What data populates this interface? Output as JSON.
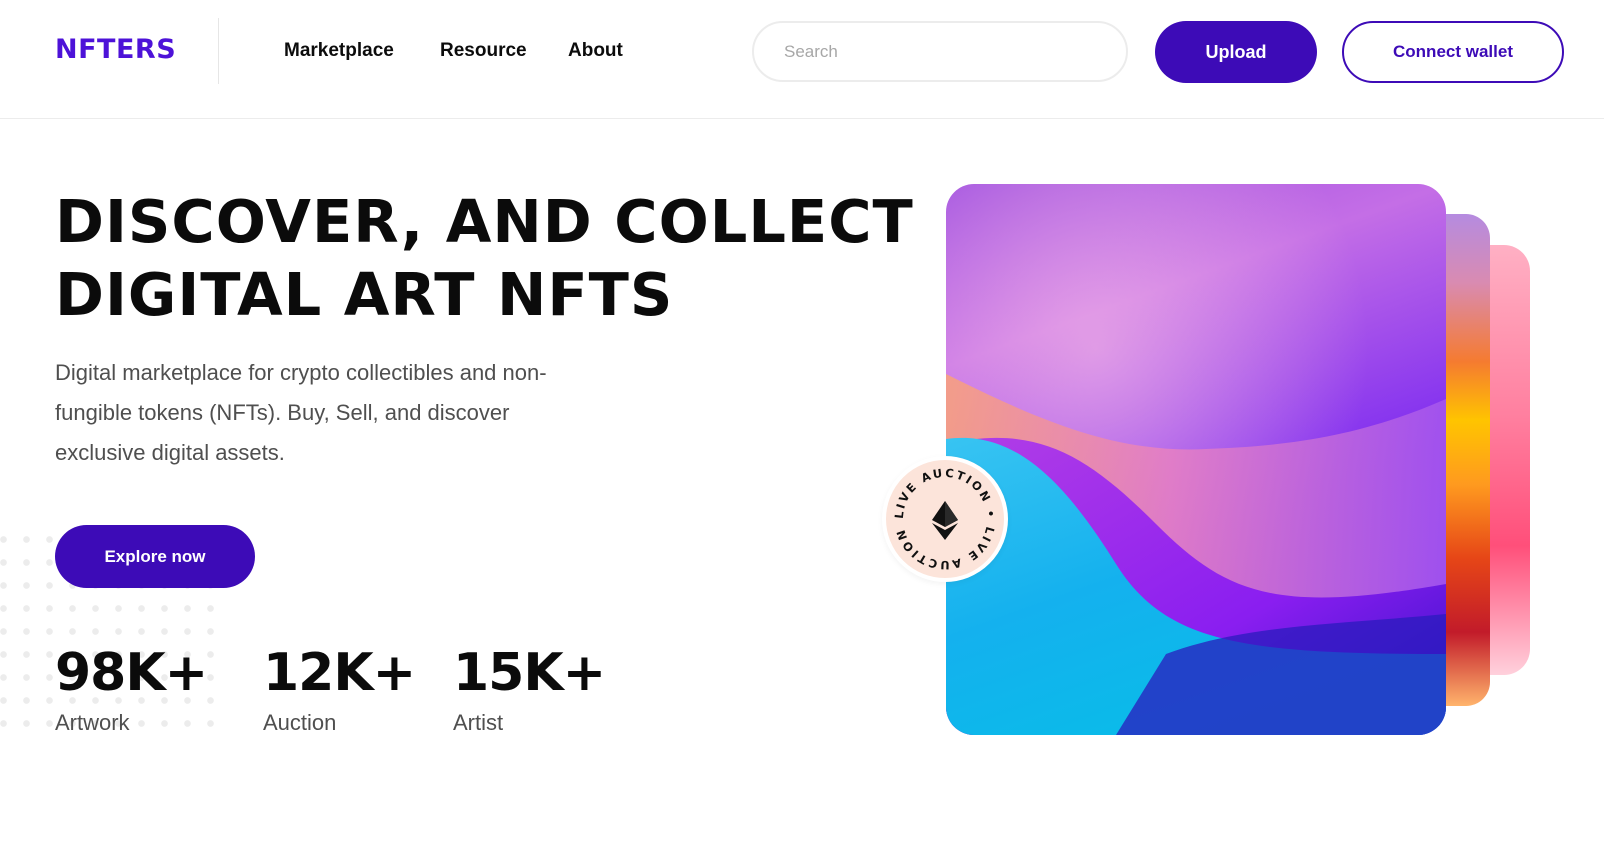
{
  "header": {
    "logo": "NFTERS",
    "nav": [
      {
        "label": "Marketplace"
      },
      {
        "label": "Resource"
      },
      {
        "label": "About"
      }
    ],
    "search_placeholder": "Search",
    "upload_label": "Upload",
    "connect_label": "Connect wallet"
  },
  "hero": {
    "title_line1": "DISCOVER, AND COLLECT",
    "title_line2": "DIGITAL ART NFTS",
    "subtitle": "Digital marketplace for crypto collectibles and non-fungible tokens (NFTs). Buy, Sell, and discover exclusive digital assets.",
    "cta_label": "Explore now",
    "stats": [
      {
        "value": "98K+",
        "label": "Artwork"
      },
      {
        "value": "12K+",
        "label": "Auction"
      },
      {
        "value": "15K+",
        "label": "Artist"
      }
    ]
  },
  "badge": {
    "ring_text": "LIVE AUCTION • LIVE AUCTION • ",
    "icon": "ethereum-icon"
  },
  "colors": {
    "brand": "#3d0bb7",
    "logo": "#4d12d8",
    "badge_bg": "#fce4da"
  }
}
